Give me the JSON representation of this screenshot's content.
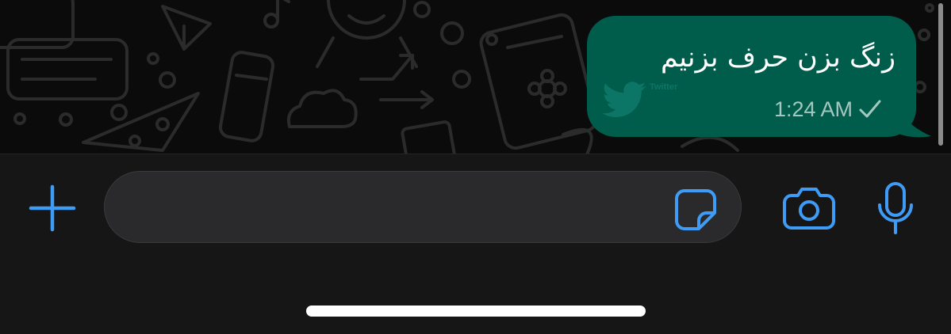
{
  "message": {
    "text": "زنگ بزن حرف بزنیم",
    "time": "1:24 AM",
    "status_icon": "single-check-icon"
  },
  "watermark": {
    "label": "Twitter",
    "icon": "twitter-bird-icon"
  },
  "composer": {
    "input_value": "",
    "input_placeholder": "",
    "icons": {
      "add": "plus-icon",
      "sticker": "sticker-icon",
      "camera": "camera-icon",
      "mic": "microphone-icon"
    }
  },
  "colors": {
    "chat_background": "#0b0b0b",
    "wallpaper_doodle": "#2b2b2b",
    "outgoing_bubble": "#005c4b",
    "input_bar": "#161616",
    "input_field": "#2a2a2c",
    "accent": "#3f9cf6",
    "meta_text": "#a3c8c0"
  }
}
